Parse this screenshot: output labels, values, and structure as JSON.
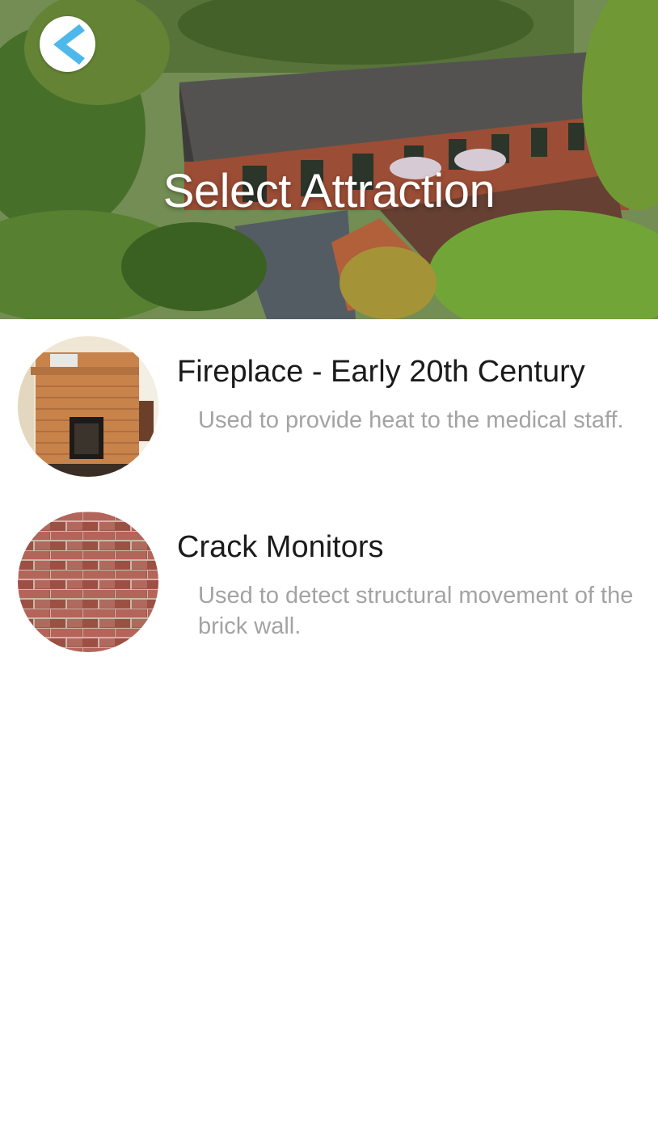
{
  "header": {
    "title": "Select Attraction",
    "back_icon": "chevron-left-icon",
    "accent_color": "#4fb8ea"
  },
  "attractions": [
    {
      "title": "Fireplace - Early 20th Century",
      "description": "Used to provide heat to the medical staff.",
      "thumbnail": "fireplace-thumbnail"
    },
    {
      "title": "Crack Monitors",
      "description": "Used to detect structural movement of the brick wall.",
      "thumbnail": "brick-wall-thumbnail"
    }
  ]
}
